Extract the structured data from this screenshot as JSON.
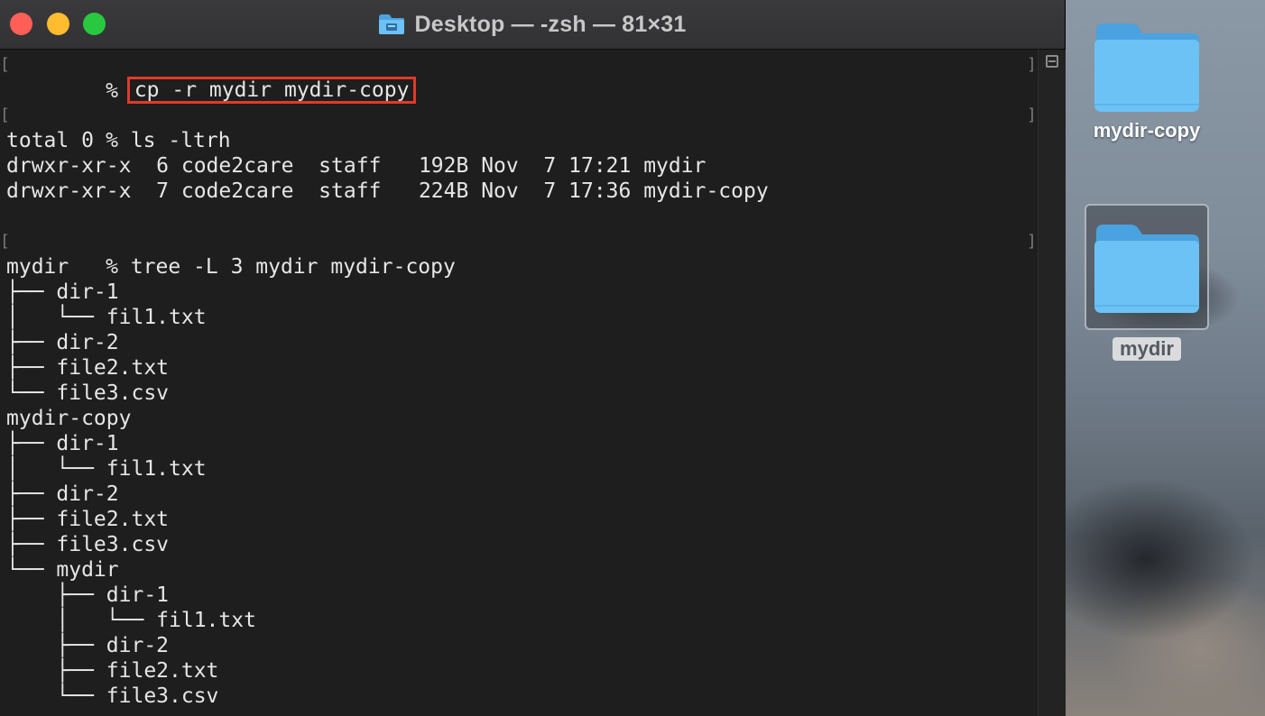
{
  "window": {
    "title": "Desktop — -zsh — 81×31",
    "title_icon": "folder-icon"
  },
  "desktop": {
    "items": [
      {
        "label": "mydir-copy",
        "icon": "folder-icon",
        "selected": false
      },
      {
        "label": "mydir",
        "icon": "folder-icon",
        "selected": true
      }
    ]
  },
  "terminal": {
    "prompt_symbol": "%",
    "bracket_left": "[",
    "bracket_right": "]",
    "commands": {
      "cp": "cp -r mydir mydir-copy",
      "ls": "ls -ltrh",
      "tree": "tree -L 3 mydir mydir-copy"
    },
    "output": {
      "ls": [
        "total 0",
        "drwxr-xr-x  6 code2care  staff   192B Nov  7 17:21 mydir",
        "drwxr-xr-x  7 code2care  staff   224B Nov  7 17:36 mydir-copy"
      ],
      "tree": [
        "mydir",
        "├── dir-1",
        "│   └── fil1.txt",
        "├── dir-2",
        "├── file2.txt",
        "└── file3.csv",
        "mydir-copy",
        "├── dir-1",
        "│   └── fil1.txt",
        "├── dir-2",
        "├── file2.txt",
        "├── file3.csv",
        "└── mydir",
        "    ├── dir-1",
        "    │   └── fil1.txt",
        "    ├── dir-2",
        "    ├── file2.txt",
        "    └── file3.csv"
      ]
    }
  },
  "colors": {
    "highlight_box": "#e03a2a",
    "terminal_bg": "#1e1e1e",
    "folder_blue": "#62b6ef"
  }
}
